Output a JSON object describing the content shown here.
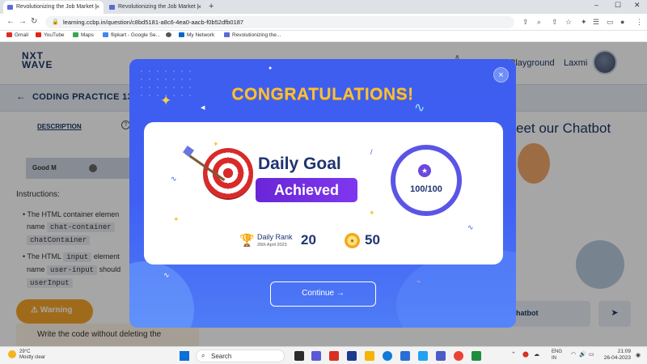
{
  "browser": {
    "tabs": [
      {
        "title": "Revolutionizing the Job Market |"
      },
      {
        "title": "Revolutionizing the Job Market |"
      }
    ],
    "url": "learning.ccbp.in/question/c8bd5181-a8c6-4ea0-aacb-f0b52dfb0187",
    "bookmarks": [
      "Gmail",
      "YouTube",
      "Maps",
      "flipkart - Google Se...",
      "My Network",
      "Revolutionizing the..."
    ]
  },
  "page": {
    "logo_line1": "NXT",
    "logo_line2": "WAVE",
    "nav_playground": "Playground",
    "user_name": "Laxmi",
    "practice_title": "CODING PRACTICE 13",
    "description_tab": "DESCRIPTION",
    "good_m": "Good M",
    "instructions": "Instructions:",
    "bullet1_pre": "The HTML container elemen",
    "bullet1_name": "name",
    "bullet1_code1": "chat-container",
    "bullet1_code2": "chatContainer",
    "bullet2_pre": "The HTML",
    "bullet2_code_input": "input",
    "bullet2_post": "element",
    "bullet2_name": "name",
    "bullet2_code1": "user-input",
    "bullet2_should": "should",
    "bullet2_code2": "userInput",
    "warning_label": "Warning",
    "warning_text": "Write the code without deleting the",
    "chatbot_heading": "eet our Chatbot",
    "chatbot_button": "hatbot"
  },
  "modal": {
    "title": "CONGRATULATIONS!",
    "goal_title": "Daily Goal",
    "goal_status": "Achieved",
    "progress_text": "100/100",
    "progress_fraction": 1.0,
    "rank_label": "Daily Rank",
    "rank_date": "26th April 2023",
    "rank_value": "20",
    "coins_value": "50",
    "continue_label": "Continue →",
    "close_symbol": "×"
  },
  "taskbar": {
    "temperature": "29°C",
    "weather": "Mostly clear",
    "search_placeholder": "Search",
    "lang_line1": "ENG",
    "lang_line2": "IN",
    "time": "21:09",
    "date": "26-04-2023"
  },
  "colors": {
    "modal_bg": "#3f5ef2",
    "congrats_gold": "#f8c03a",
    "achieved_purple": "#7e37ef",
    "ring_purple": "#5a55e6",
    "navy_text": "#1f3470"
  }
}
